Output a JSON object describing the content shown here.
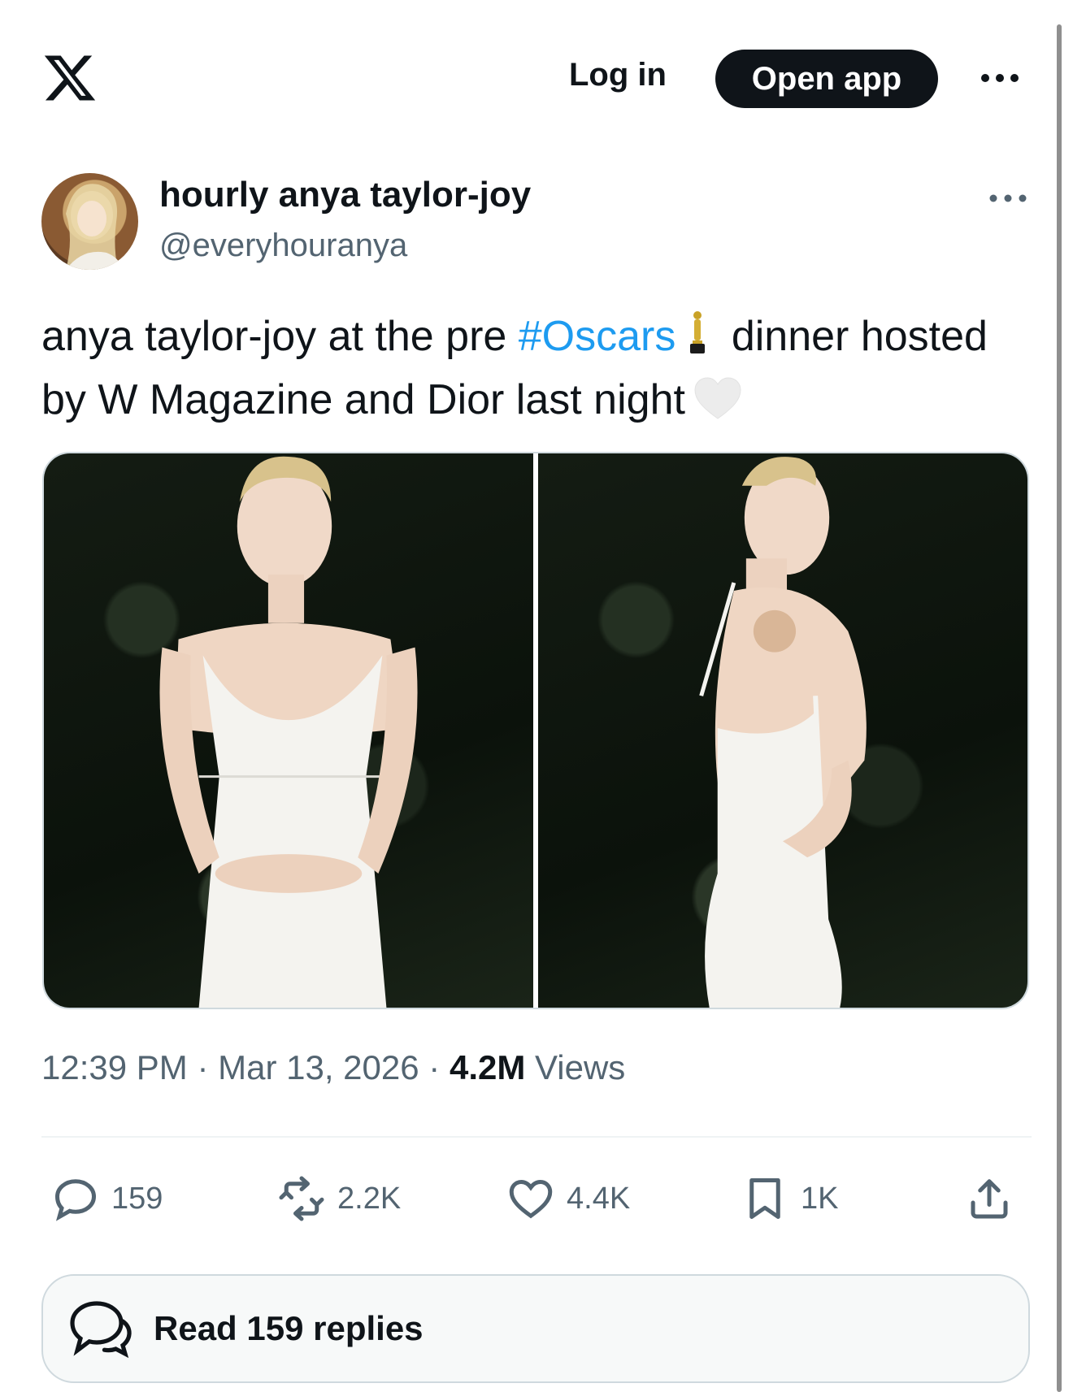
{
  "header": {
    "logo_icon": "x-logo-icon",
    "login_label": "Log in",
    "open_app_label": "Open app",
    "more_icon": "more-horizontal-icon"
  },
  "author": {
    "display_name": "hourly anya taylor-joy",
    "handle": "@everyhouranya",
    "avatar_icon": "avatar"
  },
  "tweet": {
    "text_before": "anya taylor-joy at the pre ",
    "hashtag": "#Oscars",
    "text_after": " dinner hosted by W Magazine and Dior last night",
    "emoji_1": "oscar-statuette-icon",
    "emoji_2": "white-heart-icon"
  },
  "media": {
    "photos": [
      {
        "icon": "photo-1"
      },
      {
        "icon": "photo-2"
      }
    ]
  },
  "meta": {
    "time": "12:39 PM",
    "date": "Mar 13, 2026",
    "views_count": "4.2M",
    "views_label": "Views",
    "separator": "·"
  },
  "actions": {
    "replies": "159",
    "reposts": "2.2K",
    "likes": "4.4K",
    "bookmarks": "1K"
  },
  "footer": {
    "read_replies_label": "Read 159 replies"
  },
  "colors": {
    "accent": "#1d9bf0",
    "text_primary": "#0f1419",
    "text_secondary": "#536471",
    "border": "#cfd9de"
  }
}
